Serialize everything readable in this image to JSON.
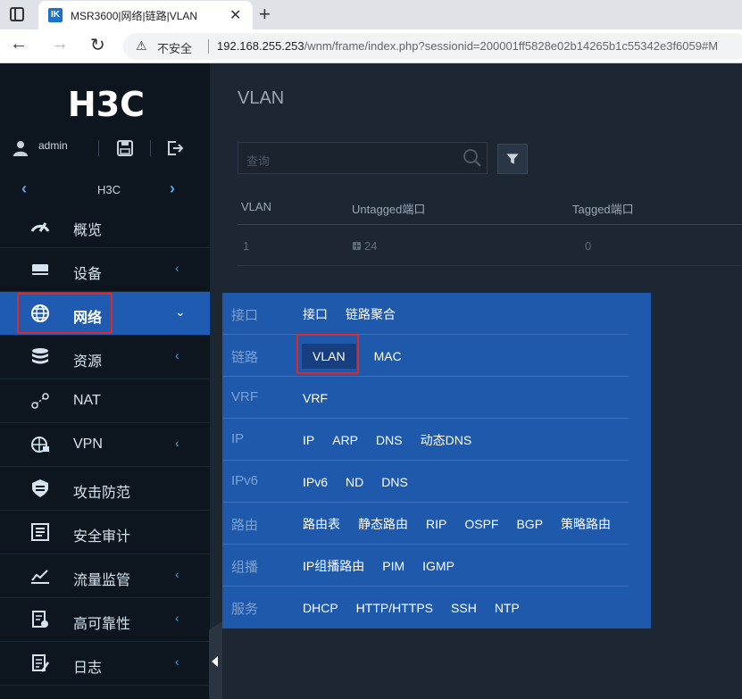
{
  "browser": {
    "tab_title": "MSR3600|网络|链路|VLAN",
    "tab_favicon": "IK",
    "insecure_label": "不安全",
    "url_host": "192.168.255.253",
    "url_path": "/wnm/frame/index.php?sessionid=200001ff5828e02b14265b1c55342e3f6059#M"
  },
  "sidebar": {
    "logo": "H3C",
    "username": "admin",
    "device_name": "H3C",
    "menu": [
      {
        "label": "概览",
        "icon": "dashboard-icon",
        "arrow": ""
      },
      {
        "label": "设备",
        "icon": "device-icon",
        "arrow": "‹"
      },
      {
        "label": "网络",
        "icon": "globe-icon",
        "arrow": "⌄"
      },
      {
        "label": "资源",
        "icon": "database-icon",
        "arrow": "‹"
      },
      {
        "label": "NAT",
        "icon": "nat-icon",
        "arrow": ""
      },
      {
        "label": "VPN",
        "icon": "vpn-icon",
        "arrow": "‹"
      },
      {
        "label": "攻击防范",
        "icon": "shield-icon",
        "arrow": ""
      },
      {
        "label": "安全审计",
        "icon": "audit-icon",
        "arrow": ""
      },
      {
        "label": "流量监管",
        "icon": "traffic-chart-icon",
        "arrow": "‹"
      },
      {
        "label": "高可靠性",
        "icon": "reliability-icon",
        "arrow": "‹"
      },
      {
        "label": "日志",
        "icon": "log-icon",
        "arrow": "‹"
      }
    ]
  },
  "main": {
    "title": "VLAN",
    "search_placeholder": "查询",
    "table": {
      "headers": [
        "VLAN",
        "Untagged端口",
        "Tagged端口"
      ],
      "rows": [
        {
          "vlan": "1",
          "untagged": "24",
          "tagged": "0"
        }
      ]
    }
  },
  "panel": {
    "rows": [
      {
        "category": "接口",
        "links": [
          "接口",
          "链路聚合"
        ]
      },
      {
        "category": "链路",
        "links": [
          "VLAN",
          "MAC"
        ]
      },
      {
        "category": "VRF",
        "links": [
          "VRF"
        ]
      },
      {
        "category": "IP",
        "links": [
          "IP",
          "ARP",
          "DNS",
          "动态DNS"
        ]
      },
      {
        "category": "IPv6",
        "links": [
          "IPv6",
          "ND",
          "DNS"
        ]
      },
      {
        "category": "路由",
        "links": [
          "路由表",
          "静态路由",
          "RIP",
          "OSPF",
          "BGP",
          "策略路由"
        ]
      },
      {
        "category": "组播",
        "links": [
          "IP组播路由",
          "PIM",
          "IGMP"
        ]
      },
      {
        "category": "服务",
        "links": [
          "DHCP",
          "HTTP/HTTPS",
          "SSH",
          "NTP"
        ]
      }
    ]
  },
  "colors": {
    "accent": "#1f5cb1",
    "highlight": "#e02828"
  }
}
